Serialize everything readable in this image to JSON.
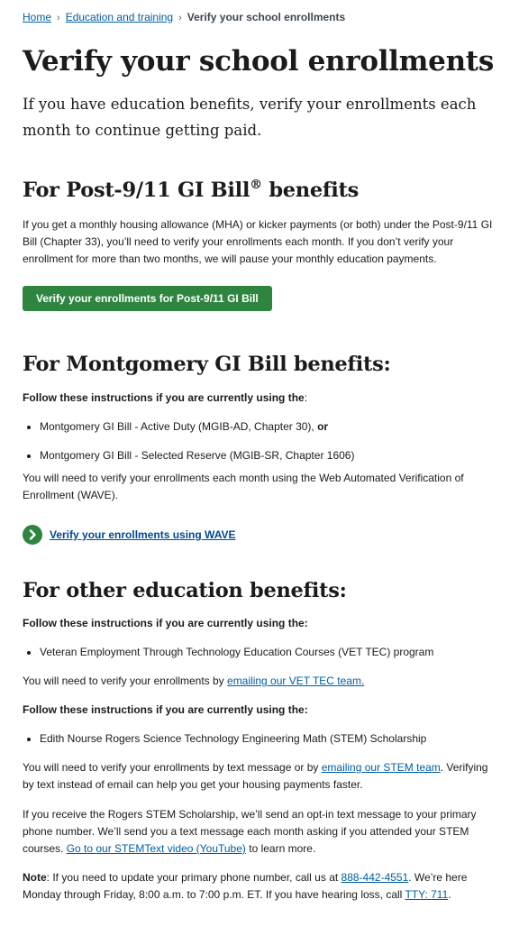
{
  "breadcrumb": {
    "home": "Home",
    "education": "Education and training",
    "current": "Verify your school enrollments",
    "separator": "›"
  },
  "page_title": "Verify your school enrollments",
  "intro": "If you have education benefits, verify your enrollments each month to continue getting paid.",
  "post911": {
    "heading_prefix": "For Post-9/11 GI Bill",
    "heading_reg": "®",
    "heading_suffix": " benefits",
    "body": "If you get a monthly housing allowance (MHA) or kicker payments (or both) under the Post-9/11 GI Bill (Chapter 33), you’ll need to verify your enrollments each month. If you don’t verify your enrollment for more than two months, we will pause your monthly education payments.",
    "button_label": "Verify your enrollments for Post-9/11 GI Bill"
  },
  "montgomery": {
    "heading": "For Montgomery GI Bill benefits:",
    "instructions_bold": "Follow these instructions if you are currently using the",
    "instructions_colon": ":",
    "items": [
      {
        "text": "Montgomery GI Bill - Active Duty (MGIB-AD, Chapter 30), ",
        "bold_suffix": "or"
      },
      {
        "text": "Montgomery GI Bill - Selected Reserve (MGIB-SR, Chapter 1606)",
        "bold_suffix": ""
      }
    ],
    "body": "You will need to verify your enrollments each month using the Web Automated Verification of Enrollment (WAVE).",
    "action_link": "Verify your enrollments using WAVE"
  },
  "other": {
    "heading": "For other education benefits:",
    "instructions_1": "Follow these instructions if you are currently using the:",
    "item_1": "Veteran Employment Through Technology Education Courses (VET TEC) program",
    "vettec_text": "You will need to verify your enrollments by ",
    "vettec_link": "emailing our VET TEC team.",
    "instructions_2": "Follow these instructions if you are currently using the:",
    "item_2": "Edith Nourse Rogers Science Technology Engineering Math (STEM) Scholarship",
    "stem_text_1": "You will need to verify your enrollments by text message or by ",
    "stem_link": "emailing our STEM team",
    "stem_text_2": ". Verifying by text instead of email can help you get your housing payments faster.",
    "rogers_text": "If you receive the Rogers STEM Scholarship, we’ll send an opt-in text message to your primary phone number. We’ll send you a text message each month asking if you attended your STEM courses. ",
    "rogers_link": "Go to our STEMText video (YouTube)",
    "rogers_after": " to learn more.",
    "note_label": "Note",
    "note_text_1": ": If you need to update your primary phone number, call us at ",
    "note_phone": "888-442-4551",
    "note_text_2": ". We’re here Monday through Friday, 8:00 a.m. to 7:00 p.m. ET. If you have hearing loss, call ",
    "note_tty": "TTY: 711",
    "note_end": "."
  },
  "colors": {
    "button_green": "#2e8540",
    "link_blue": "#005ea2",
    "text": "#1b1b1b"
  },
  "icons": {
    "action_link_icon": "chevron-right-circle-icon"
  }
}
